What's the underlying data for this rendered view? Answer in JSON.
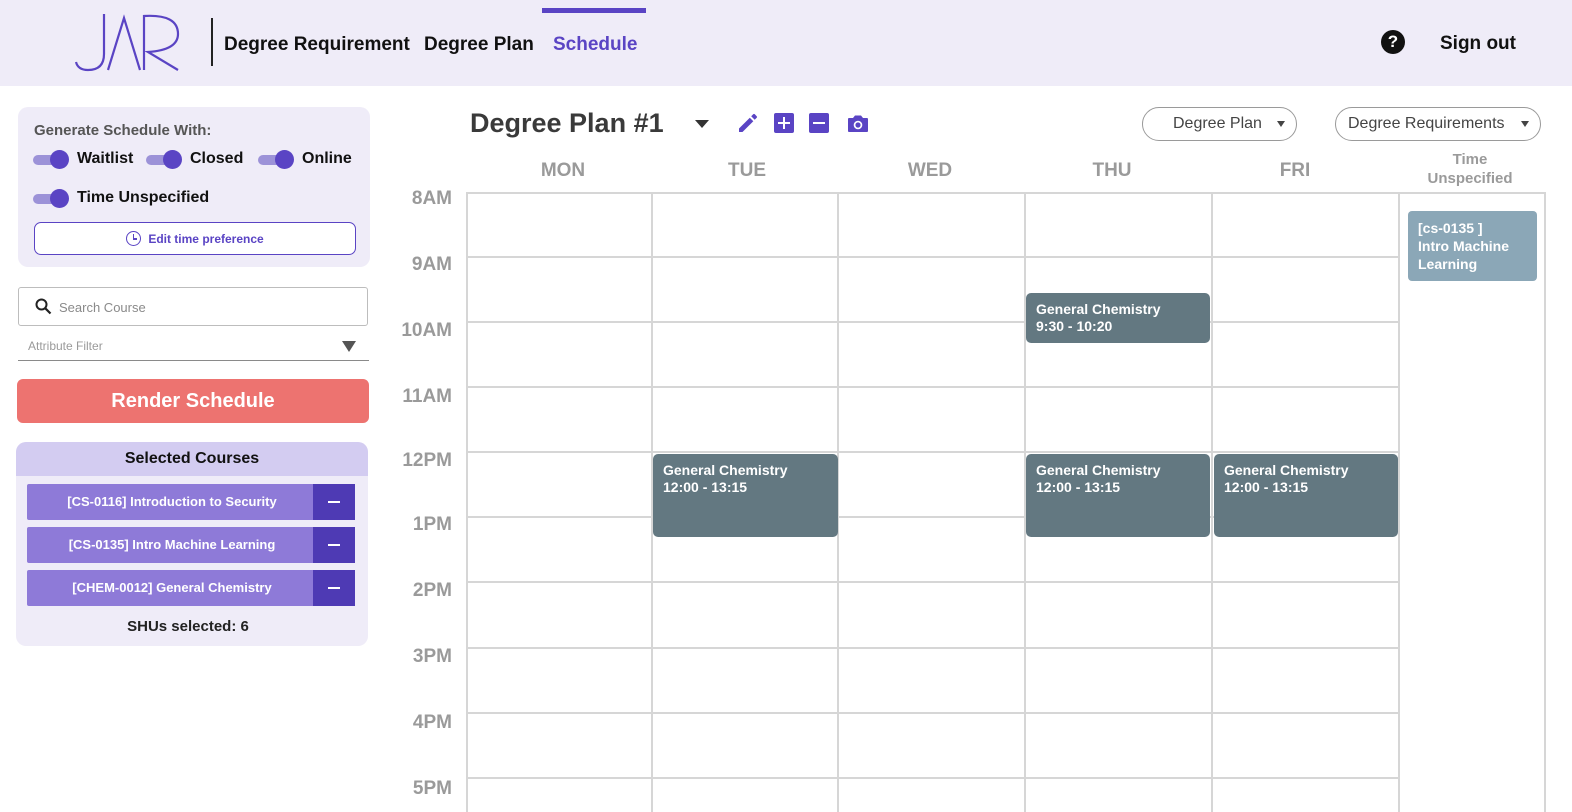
{
  "nav": {
    "logo_text": "JAR",
    "links": [
      "Degree Requirement",
      "Degree Plan",
      "Schedule"
    ],
    "active": "Schedule",
    "signout": "Sign out",
    "help_glyph": "?"
  },
  "generate": {
    "title": "Generate Schedule With:",
    "toggles": [
      {
        "label": "Waitlist",
        "on": true
      },
      {
        "label": "Closed",
        "on": true
      },
      {
        "label": "Online",
        "on": true
      },
      {
        "label": "Time Unspecified",
        "on": true
      }
    ],
    "edit_time_label": "Edit time preference"
  },
  "search": {
    "placeholder": "Search Course",
    "value": ""
  },
  "attribute_filter": {
    "label": "Attribute Filter"
  },
  "render_button": "Render Schedule",
  "selected": {
    "title": "Selected Courses",
    "courses": [
      "[CS-0116] Introduction to Security",
      "[CS-0135] Intro Machine Learning",
      "[CHEM-0012] General Chemistry"
    ],
    "summary": "SHUs selected: 6"
  },
  "plan": {
    "title": "Degree Plan #1",
    "dropdowns": [
      "Degree Plan",
      "Degree Requirements"
    ]
  },
  "calendar": {
    "days": [
      "MON",
      "TUE",
      "WED",
      "THU",
      "FRI"
    ],
    "unspecified_header": [
      "Time",
      "Unspecified"
    ],
    "hours": [
      "8AM",
      "9AM",
      "10AM",
      "11AM",
      "12PM",
      "1PM",
      "2PM",
      "3PM",
      "4PM",
      "5PM"
    ],
    "events": [
      {
        "name": "General Chemistry",
        "time": "9:30 - 10:20",
        "day": "THU"
      },
      {
        "name": "General Chemistry",
        "time": "12:00 - 13:15",
        "day": "TUE"
      },
      {
        "name": "General Chemistry",
        "time": "12:00 - 13:15",
        "day": "THU"
      },
      {
        "name": "General Chemistry",
        "time": "12:00 - 13:15",
        "day": "FRI"
      }
    ],
    "unspecified_events": [
      {
        "code": "[cs-0135 ]",
        "name": "Intro Machine Learning"
      }
    ]
  },
  "colors": {
    "accent": "#5a44c4",
    "topbar": "#efecf8",
    "render": "#ed7370",
    "event": "#637881",
    "event_unspecified": "#8ba7b7",
    "course_row": "#8e7ad8"
  }
}
